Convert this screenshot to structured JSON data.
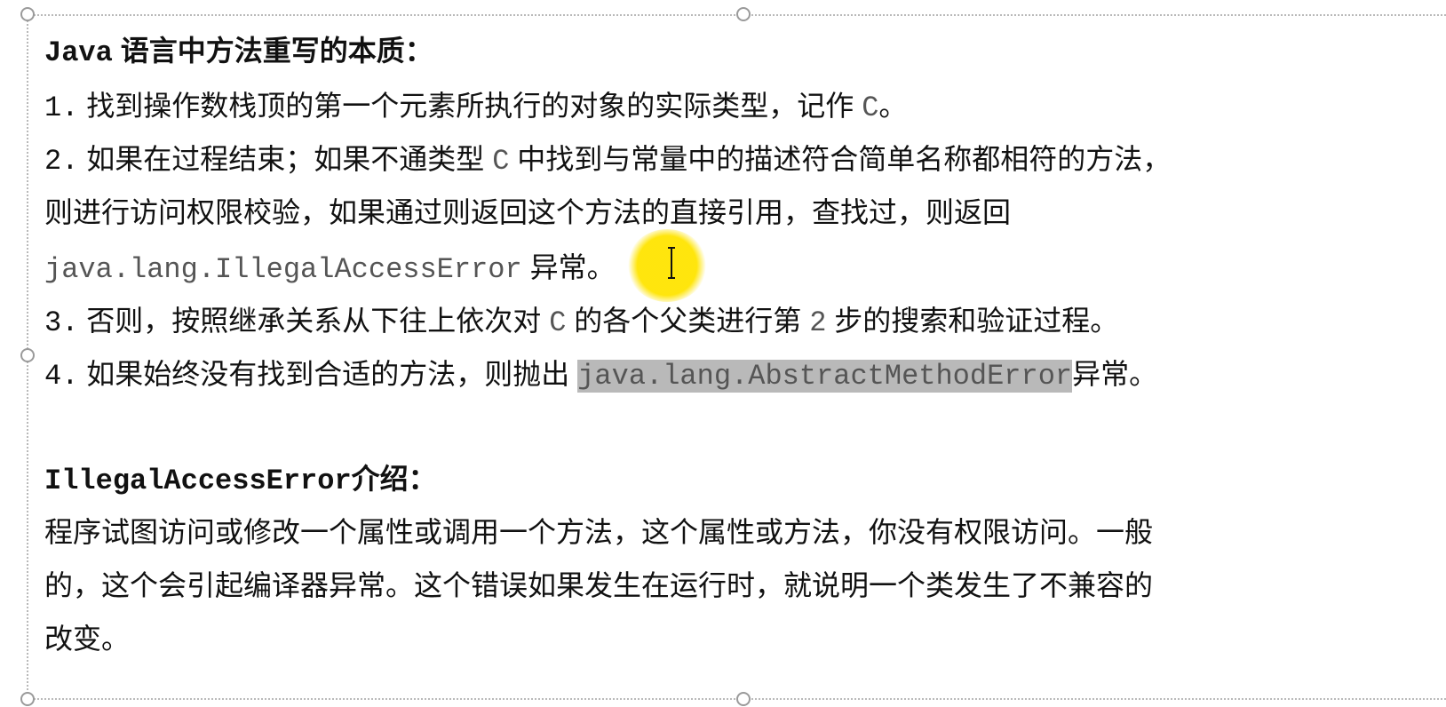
{
  "heading": {
    "prefix": "Java",
    "title": " 语言中方法重写的本质："
  },
  "steps": [
    {
      "num": "1.",
      "text": " 找到操作数栈顶的第一个元素所执行的对象的实际类型，记作 ",
      "code": "C",
      "tail": "。"
    },
    {
      "num": "2.",
      "text": " 如果在过程结束；如果不通类型 ",
      "code": "C",
      "tail": " 中找到与常量中的描述符合简单名称都相符的方法，"
    },
    {
      "text": "则进行访问权限校验，如果通过则返回这个方法的直接引用，查找过，则返回"
    },
    {
      "code": "java.lang.IllegalAccessError",
      "tail": " 异常。"
    },
    {
      "num": "3.",
      "text": " 否则，按照继承关系从下往上依次对 ",
      "code": "C",
      "mid": " 的各个父类进行第 ",
      "code2": "2",
      "tail": " 步的搜索和验证过程。"
    },
    {
      "num": "4.",
      "text": " 如果始终没有找到合适的方法，则抛出 ",
      "code": "java.lang.AbstractMethodError",
      "tail": "异常。"
    }
  ],
  "section2": {
    "prefix": "IllegalAccessError",
    "title": "介绍："
  },
  "paragraph": [
    "程序试图访问或修改一个属性或调用一个方法，这个属性或方法，你没有权限访问。一般",
    "的，这个会引起编译器异常。这个错误如果发生在运行时，就说明一个类发生了不兼容的",
    "改变。"
  ],
  "colors": {
    "text": "#111111",
    "code_text": "#555555",
    "selection": "#b9b9b9",
    "cursor_highlight": "#ffe400"
  }
}
